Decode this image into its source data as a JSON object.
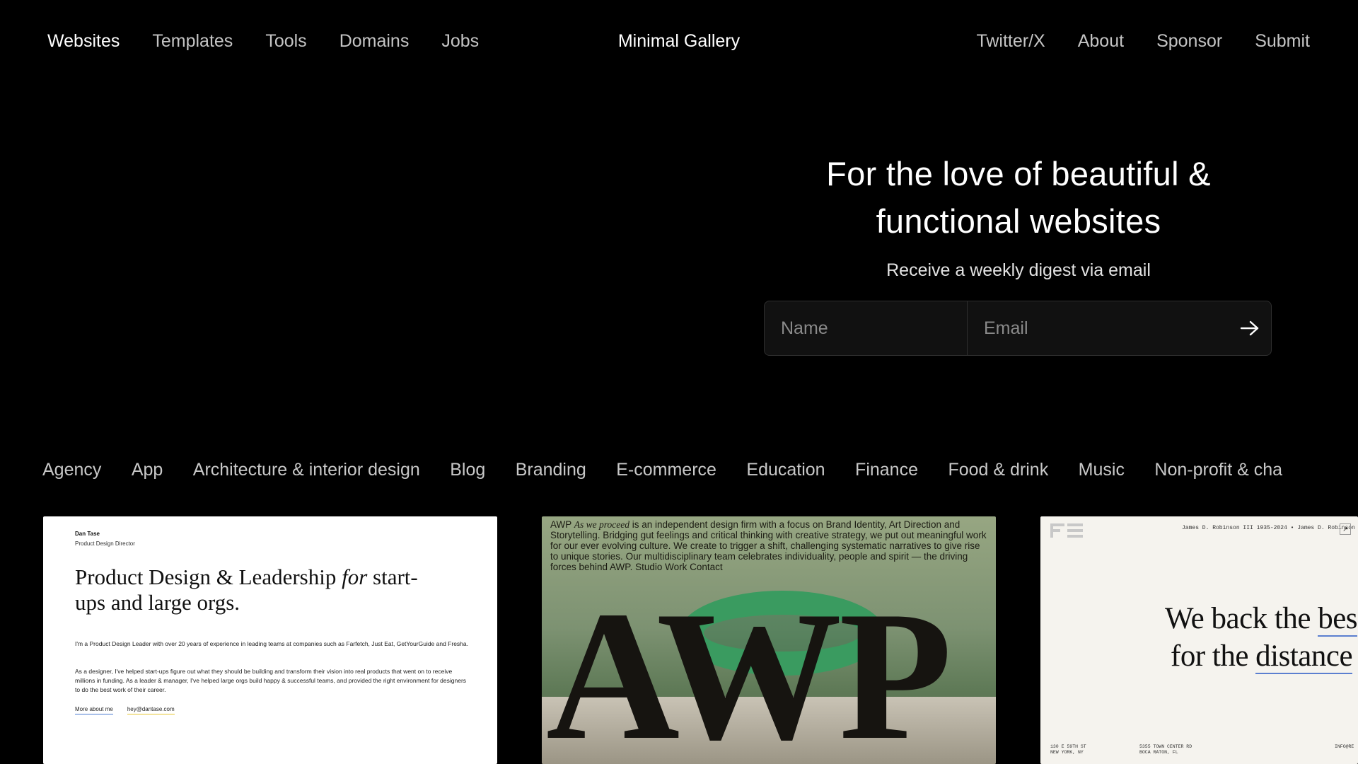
{
  "nav": {
    "left": [
      "Websites",
      "Templates",
      "Tools",
      "Domains",
      "Jobs"
    ],
    "brand": "Minimal Gallery",
    "right": [
      "Twitter/X",
      "About",
      "Sponsor",
      "Submit"
    ]
  },
  "hero": {
    "title_line1": "For the love of beautiful &",
    "title_line2": "functional websites",
    "subtitle": "Receive a weekly digest via email",
    "name_placeholder": "Name",
    "email_placeholder": "Email",
    "submit_icon": "arrow-right-icon"
  },
  "categories": [
    "Agency",
    "App",
    "Architecture & interior design",
    "Blog",
    "Branding",
    "E-commerce",
    "Education",
    "Finance",
    "Food & drink",
    "Music",
    "Non-profit & cha"
  ],
  "cards": {
    "card1": {
      "name": "Dan Tase",
      "role": "Product Design Director",
      "headline_a": "Product Design & Leadership ",
      "headline_em": "for",
      "headline_b": " start-ups and large orgs.",
      "para1": "I'm a Product Design Leader with over 20 years of experience in leading teams at companies such as Farfetch, Just Eat, GetYourGuide and Fresha.",
      "para2": "As a designer, I've helped start-ups figure out what they should be building and transform their vision into real products that went on to receive millions in funding. As a leader & manager, I've helped large orgs build happy & successful teams, and provided the right environment for designers to do the best work of their career.",
      "link1": "More about me",
      "link2": "hey@dantase.com"
    },
    "card2": {
      "lead": "AWP ",
      "lead_em": "As we proceed",
      "text": " is an independent design firm with a focus on Brand Identity, Art Direction and Storytelling. Bridging gut feelings and critical thinking with creative strategy, we put out meaningful work for our ever evolving culture. We create to trigger a shift, challenging systematic narratives to give rise to unique stories. Our multidisciplinary team celebrates individuality, people and spirit — the driving forces behind AWP. Studio Work Contact",
      "logo": "AWP"
    },
    "card3": {
      "top": "James D. Robinson III 1935-2024  •  James D. Robinson",
      "line1_a": "We back the ",
      "line1_u": "bes",
      "line2_a": "for the ",
      "line2_u": "distance",
      "foot1_a": "130 E 59TH ST",
      "foot1_b": "NEW YORK, NY",
      "foot2_a": "5355 TOWN CENTER RD",
      "foot2_b": "BOCA RATON, FL",
      "foot3": "INFO@RE"
    }
  }
}
